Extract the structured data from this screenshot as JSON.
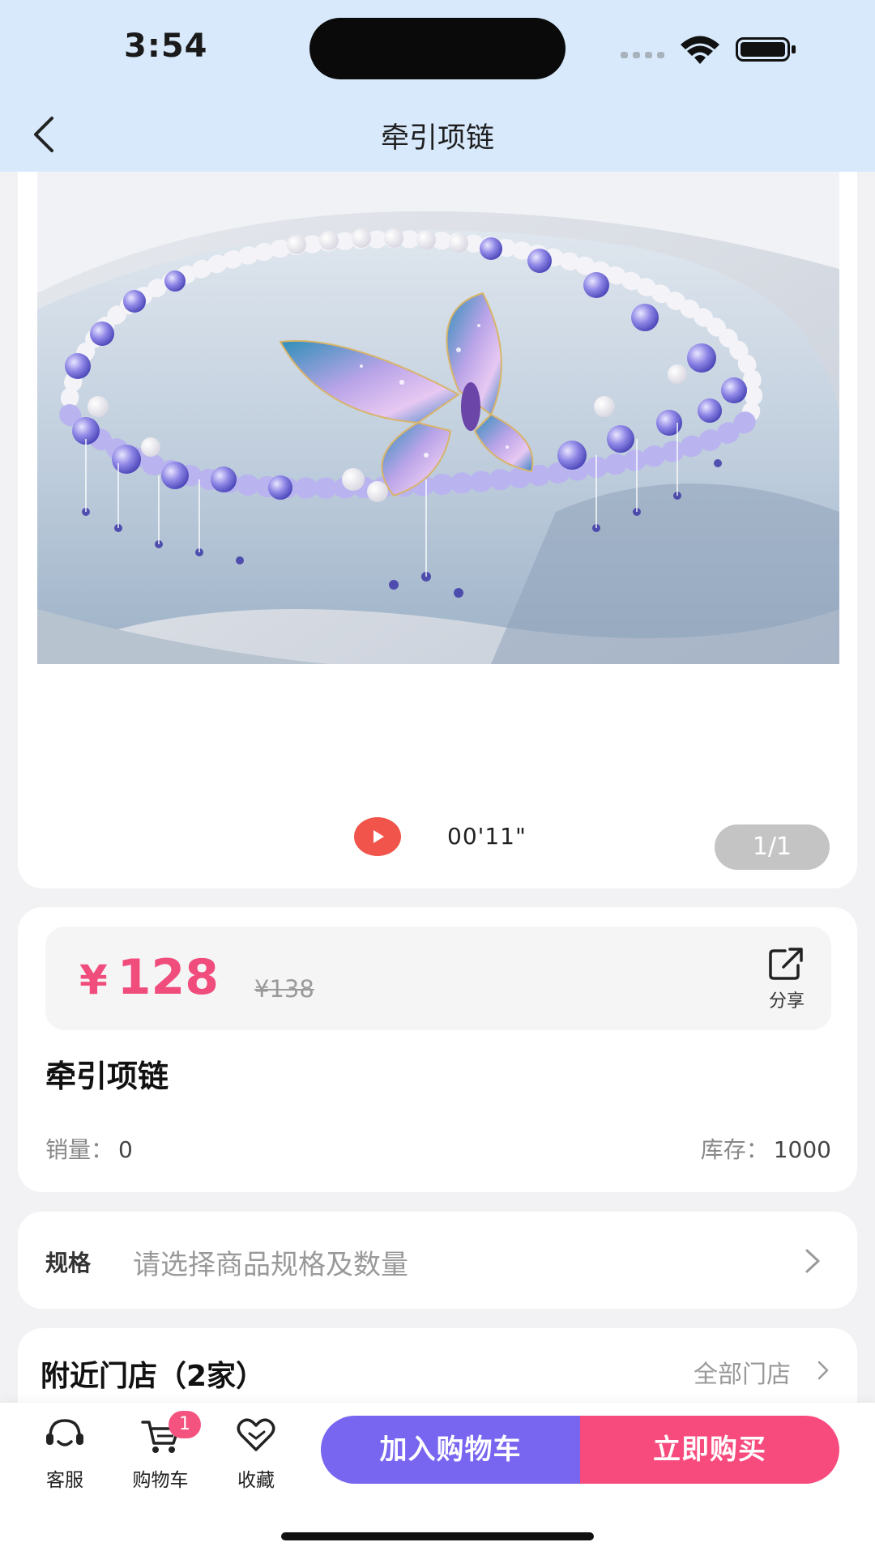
{
  "status_bar": {
    "time": "3:54"
  },
  "nav": {
    "title": "牵引项链"
  },
  "media": {
    "image_alt": "蝴蝶水晶串珠项链",
    "video_duration": "00'11\"",
    "page_counter": "1/1"
  },
  "product": {
    "currency": "¥",
    "price": "128",
    "original_price": "¥138",
    "share_label": "分享",
    "name": "牵引项链",
    "sales_label": "销量：",
    "sales_value": "0",
    "stock_label": "库存：",
    "stock_value": "1000"
  },
  "spec": {
    "label": "规格",
    "placeholder": "请选择商品规格及数量"
  },
  "stores": {
    "title": "附近门店（2家）",
    "all_link": "全部门店"
  },
  "bottom_bar": {
    "service_label": "客服",
    "cart_label": "购物车",
    "cart_badge": "1",
    "favorite_label": "收藏",
    "add_to_cart": "加入购物车",
    "buy_now": "立即购买"
  },
  "colors": {
    "header_bg": "#d7e9fb",
    "price": "#f04c7c",
    "cart_button": "#7866f0",
    "buy_button": "#f74b7d",
    "play": "#f0544a"
  }
}
